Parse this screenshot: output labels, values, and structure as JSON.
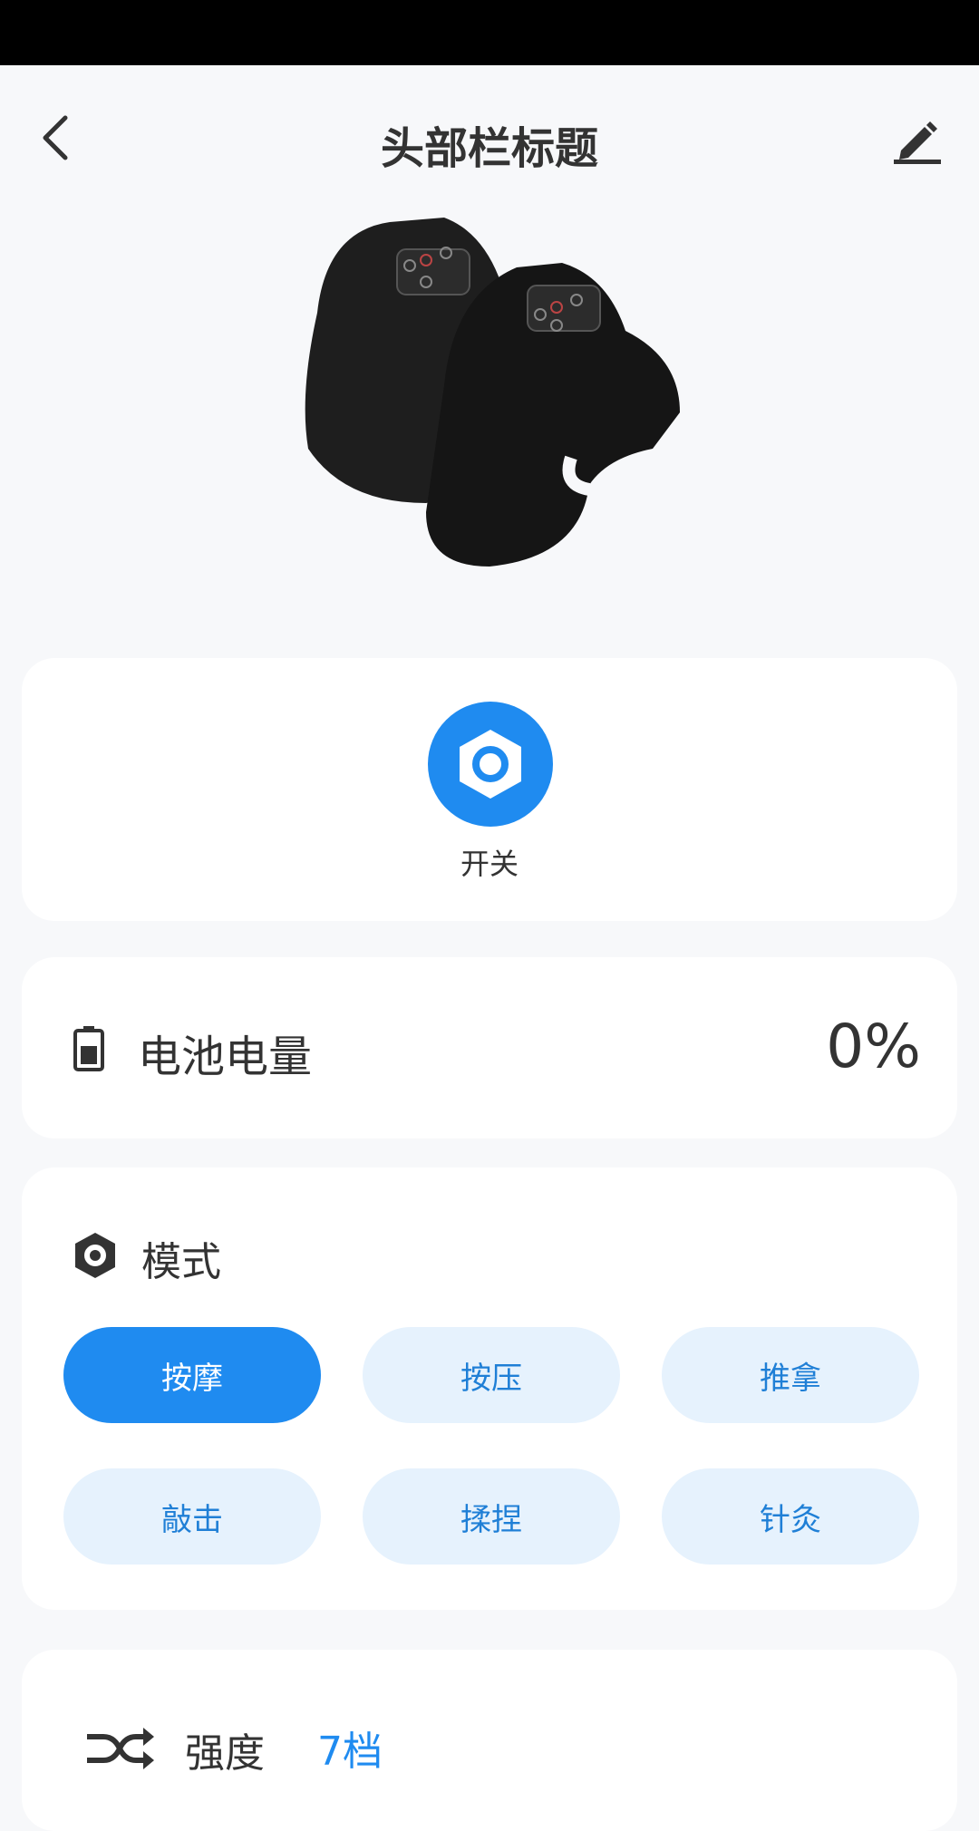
{
  "header": {
    "title": "头部栏标题",
    "back_icon": "chevron-left-icon",
    "edit_icon": "pencil-icon"
  },
  "product": {
    "image": "knee-massager-device"
  },
  "power": {
    "label": "开关",
    "icon": "hexagon-power-icon",
    "color": "#1f8bf0"
  },
  "battery": {
    "label": "电池电量",
    "value": "0%",
    "icon": "battery-icon"
  },
  "mode": {
    "label": "模式",
    "icon": "hexagon-nut-icon",
    "options": [
      {
        "label": "按摩",
        "active": true
      },
      {
        "label": "按压",
        "active": false
      },
      {
        "label": "推拿",
        "active": false
      },
      {
        "label": "敲击",
        "active": false
      },
      {
        "label": "揉捏",
        "active": false
      },
      {
        "label": "针灸",
        "active": false
      }
    ]
  },
  "strength": {
    "label": "强度",
    "value": "7档",
    "icon": "shuffle-icon"
  },
  "colors": {
    "accent": "#1f8bf0",
    "chip_bg": "#e6f2fd",
    "page_bg": "#f7f8fa"
  }
}
